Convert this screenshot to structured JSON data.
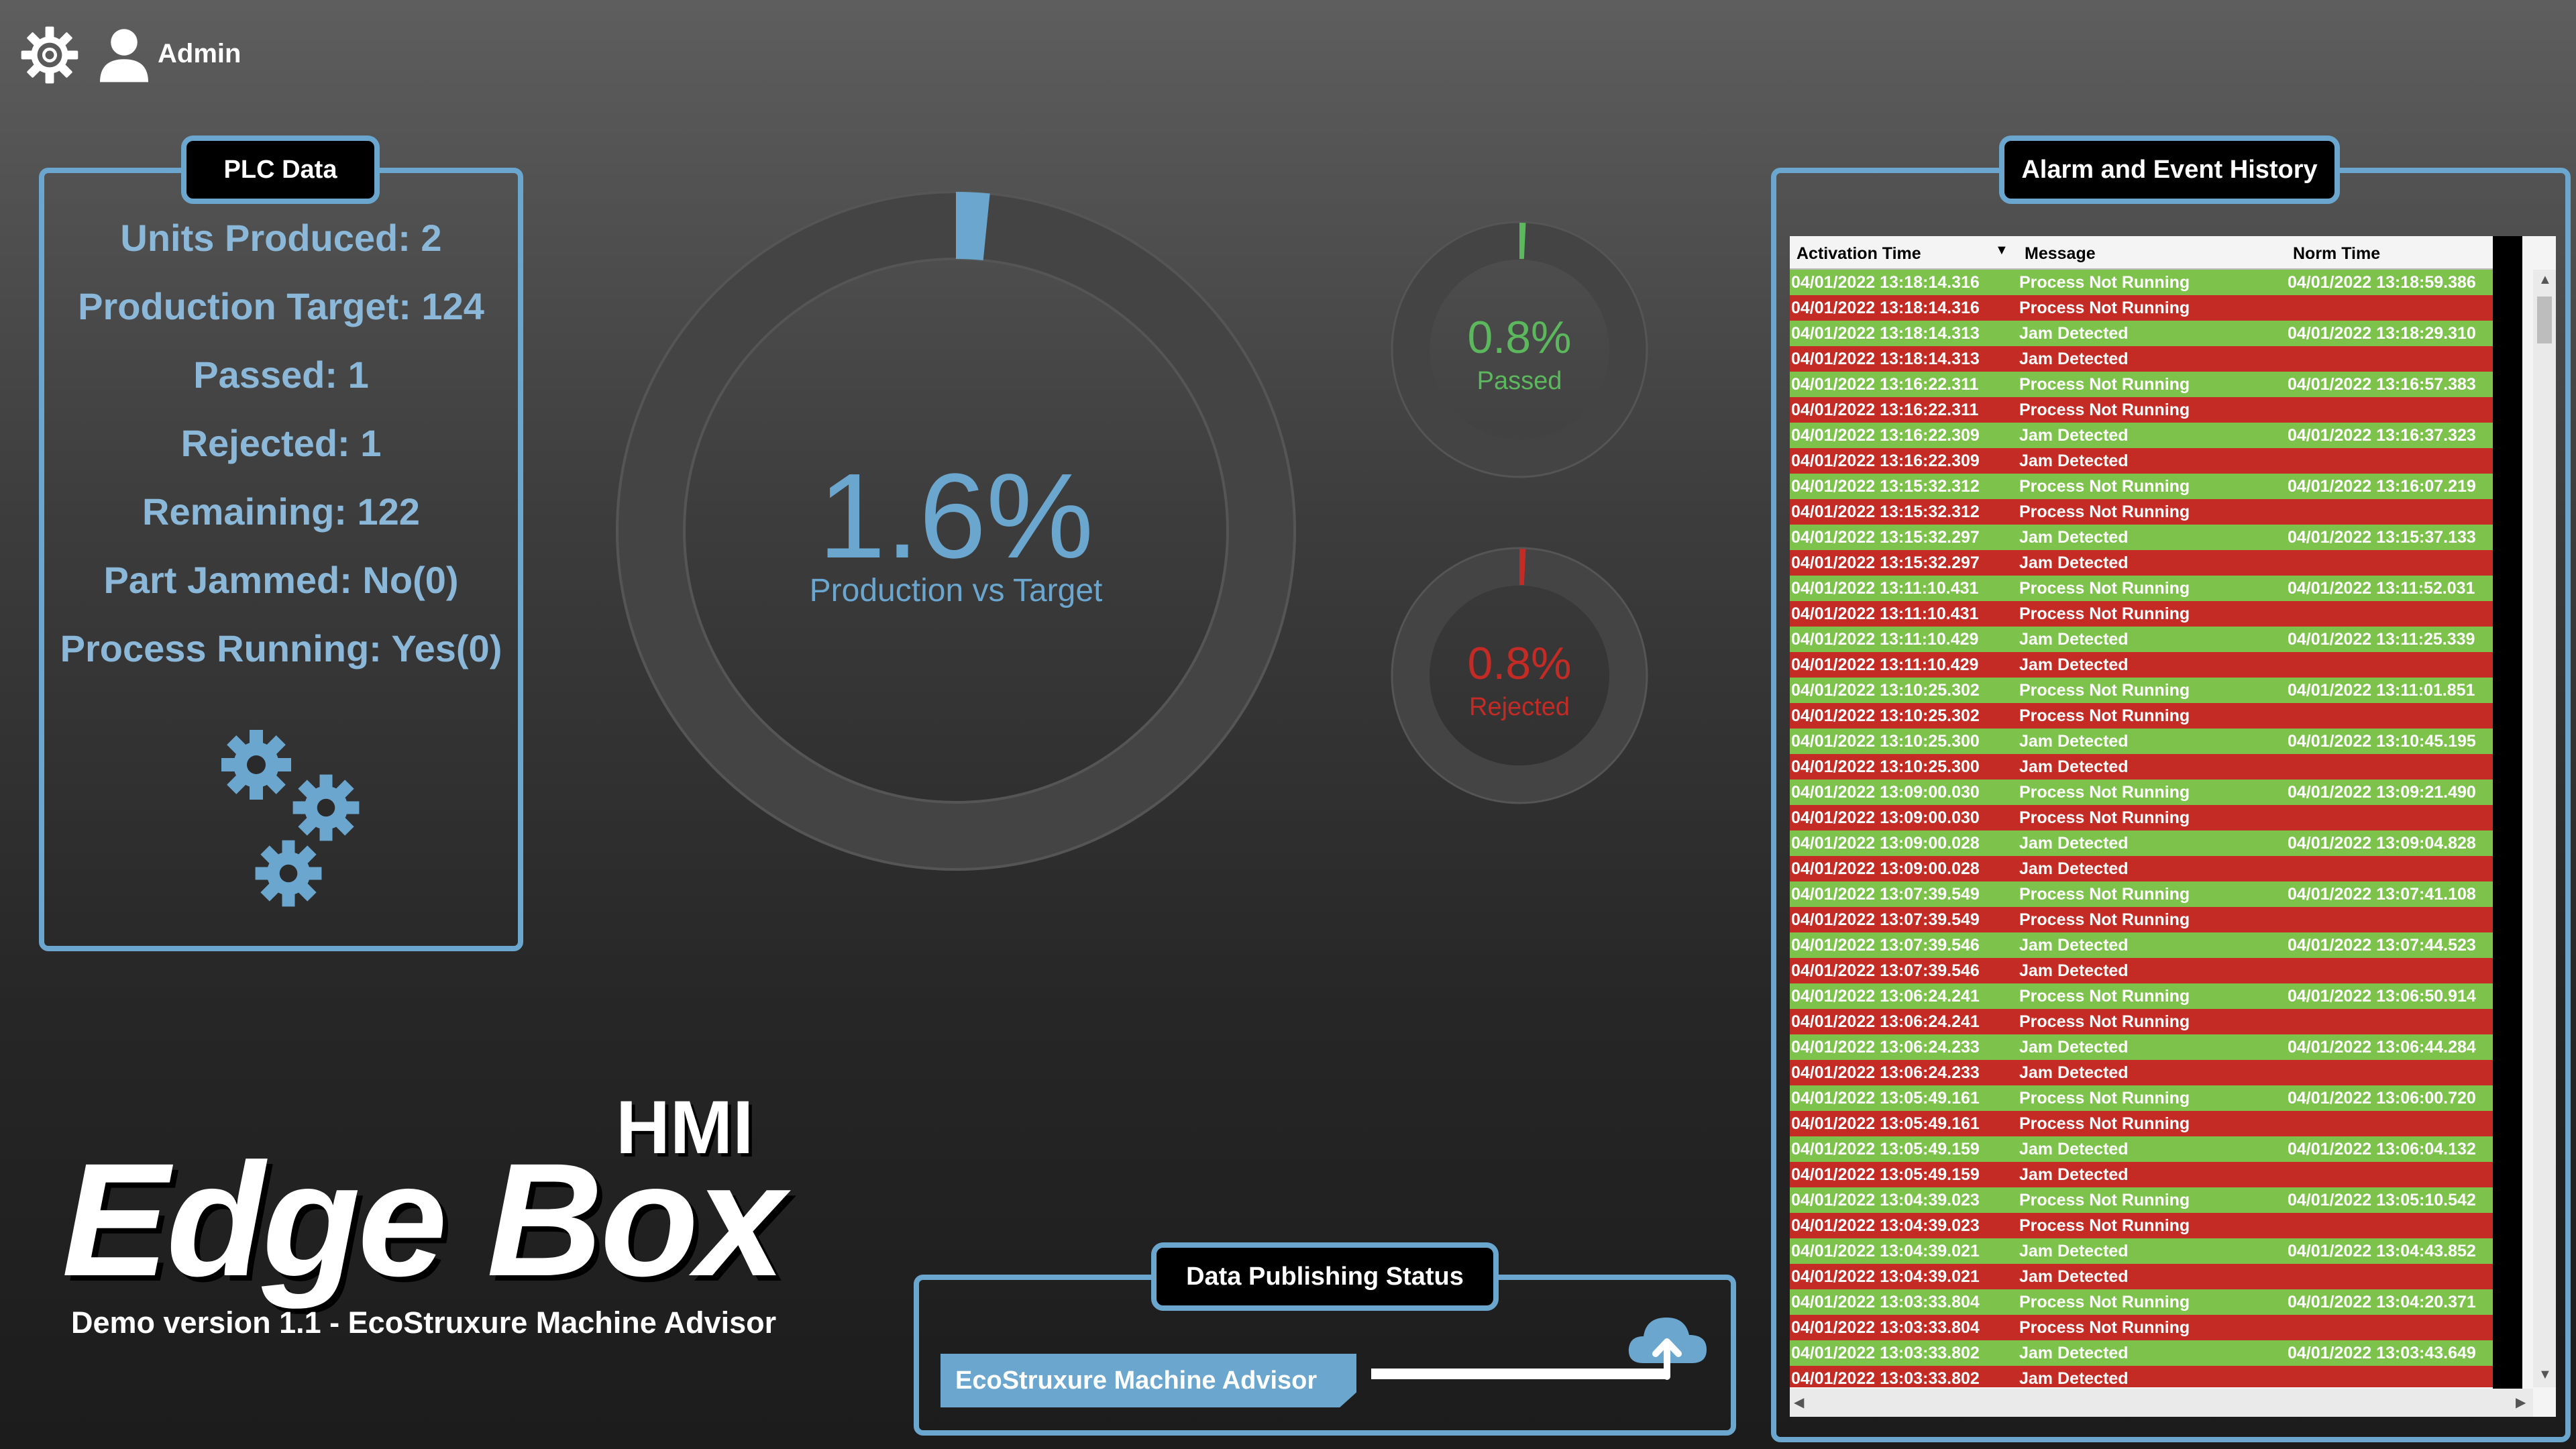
{
  "header": {
    "user_name": "Admin"
  },
  "plc": {
    "title": "PLC Data",
    "lines": [
      "Units Produced: 2",
      "Production Target: 124",
      "Passed: 1",
      "Rejected: 1",
      "Remaining: 122",
      "Part Jammed: No(0)",
      "Process Running: Yes(0)"
    ]
  },
  "gauges": {
    "production": {
      "value_text": "1.6%",
      "label": "Production vs Target",
      "fraction": 0.016,
      "color": "#6ba6cf"
    },
    "passed": {
      "value_text": "0.8%",
      "label": "Passed",
      "fraction": 0.008,
      "color": "#5cb85c"
    },
    "rejected": {
      "value_text": "0.8%",
      "label": "Rejected",
      "fraction": 0.008,
      "color": "#c42b25"
    }
  },
  "alarm": {
    "title": "Alarm and Event History",
    "columns": [
      "Activation Time",
      "Message",
      "Norm Time"
    ],
    "rows": [
      [
        "04/01/2022 13:18:14.316",
        "Process Not Running",
        "04/01/2022 13:18:59.386",
        "g"
      ],
      [
        "04/01/2022 13:18:14.316",
        "Process Not Running",
        "",
        "r"
      ],
      [
        "04/01/2022 13:18:14.313",
        "Jam Detected",
        "04/01/2022 13:18:29.310",
        "g"
      ],
      [
        "04/01/2022 13:18:14.313",
        "Jam Detected",
        "",
        "r"
      ],
      [
        "04/01/2022 13:16:22.311",
        "Process Not Running",
        "04/01/2022 13:16:57.383",
        "g"
      ],
      [
        "04/01/2022 13:16:22.311",
        "Process Not Running",
        "",
        "r"
      ],
      [
        "04/01/2022 13:16:22.309",
        "Jam Detected",
        "04/01/2022 13:16:37.323",
        "g"
      ],
      [
        "04/01/2022 13:16:22.309",
        "Jam Detected",
        "",
        "r"
      ],
      [
        "04/01/2022 13:15:32.312",
        "Process Not Running",
        "04/01/2022 13:16:07.219",
        "g"
      ],
      [
        "04/01/2022 13:15:32.312",
        "Process Not Running",
        "",
        "r"
      ],
      [
        "04/01/2022 13:15:32.297",
        "Jam Detected",
        "04/01/2022 13:15:37.133",
        "g"
      ],
      [
        "04/01/2022 13:15:32.297",
        "Jam Detected",
        "",
        "r"
      ],
      [
        "04/01/2022 13:11:10.431",
        "Process Not Running",
        "04/01/2022 13:11:52.031",
        "g"
      ],
      [
        "04/01/2022 13:11:10.431",
        "Process Not Running",
        "",
        "r"
      ],
      [
        "04/01/2022 13:11:10.429",
        "Jam Detected",
        "04/01/2022 13:11:25.339",
        "g"
      ],
      [
        "04/01/2022 13:11:10.429",
        "Jam Detected",
        "",
        "r"
      ],
      [
        "04/01/2022 13:10:25.302",
        "Process Not Running",
        "04/01/2022 13:11:01.851",
        "g"
      ],
      [
        "04/01/2022 13:10:25.302",
        "Process Not Running",
        "",
        "r"
      ],
      [
        "04/01/2022 13:10:25.300",
        "Jam Detected",
        "04/01/2022 13:10:45.195",
        "g"
      ],
      [
        "04/01/2022 13:10:25.300",
        "Jam Detected",
        "",
        "r"
      ],
      [
        "04/01/2022 13:09:00.030",
        "Process Not Running",
        "04/01/2022 13:09:21.490",
        "g"
      ],
      [
        "04/01/2022 13:09:00.030",
        "Process Not Running",
        "",
        "r"
      ],
      [
        "04/01/2022 13:09:00.028",
        "Jam Detected",
        "04/01/2022 13:09:04.828",
        "g"
      ],
      [
        "04/01/2022 13:09:00.028",
        "Jam Detected",
        "",
        "r"
      ],
      [
        "04/01/2022 13:07:39.549",
        "Process Not Running",
        "04/01/2022 13:07:41.108",
        "g"
      ],
      [
        "04/01/2022 13:07:39.549",
        "Process Not Running",
        "",
        "r"
      ],
      [
        "04/01/2022 13:07:39.546",
        "Jam Detected",
        "04/01/2022 13:07:44.523",
        "g"
      ],
      [
        "04/01/2022 13:07:39.546",
        "Jam Detected",
        "",
        "r"
      ],
      [
        "04/01/2022 13:06:24.241",
        "Process Not Running",
        "04/01/2022 13:06:50.914",
        "g"
      ],
      [
        "04/01/2022 13:06:24.241",
        "Process Not Running",
        "",
        "r"
      ],
      [
        "04/01/2022 13:06:24.233",
        "Jam Detected",
        "04/01/2022 13:06:44.284",
        "g"
      ],
      [
        "04/01/2022 13:06:24.233",
        "Jam Detected",
        "",
        "r"
      ],
      [
        "04/01/2022 13:05:49.161",
        "Process Not Running",
        "04/01/2022 13:06:00.720",
        "g"
      ],
      [
        "04/01/2022 13:05:49.161",
        "Process Not Running",
        "",
        "r"
      ],
      [
        "04/01/2022 13:05:49.159",
        "Jam Detected",
        "04/01/2022 13:06:04.132",
        "g"
      ],
      [
        "04/01/2022 13:05:49.159",
        "Jam Detected",
        "",
        "r"
      ],
      [
        "04/01/2022 13:04:39.023",
        "Process Not Running",
        "04/01/2022 13:05:10.542",
        "g"
      ],
      [
        "04/01/2022 13:04:39.023",
        "Process Not Running",
        "",
        "r"
      ],
      [
        "04/01/2022 13:04:39.021",
        "Jam Detected",
        "04/01/2022 13:04:43.852",
        "g"
      ],
      [
        "04/01/2022 13:04:39.021",
        "Jam Detected",
        "",
        "r"
      ],
      [
        "04/01/2022 13:03:33.804",
        "Process Not Running",
        "04/01/2022 13:04:20.371",
        "g"
      ],
      [
        "04/01/2022 13:03:33.804",
        "Process Not Running",
        "",
        "r"
      ],
      [
        "04/01/2022 13:03:33.802",
        "Jam Detected",
        "04/01/2022 13:03:43.649",
        "g"
      ],
      [
        "04/01/2022 13:03:33.802",
        "Jam Detected",
        "",
        "r"
      ]
    ]
  },
  "branding": {
    "main": "Edge Box",
    "hmi": "HMI",
    "subtitle": "Demo version 1.1 - EcoStruxure Machine Advisor"
  },
  "publishing": {
    "title": "Data Publishing Status",
    "target": "EcoStruxure Machine Advisor"
  }
}
